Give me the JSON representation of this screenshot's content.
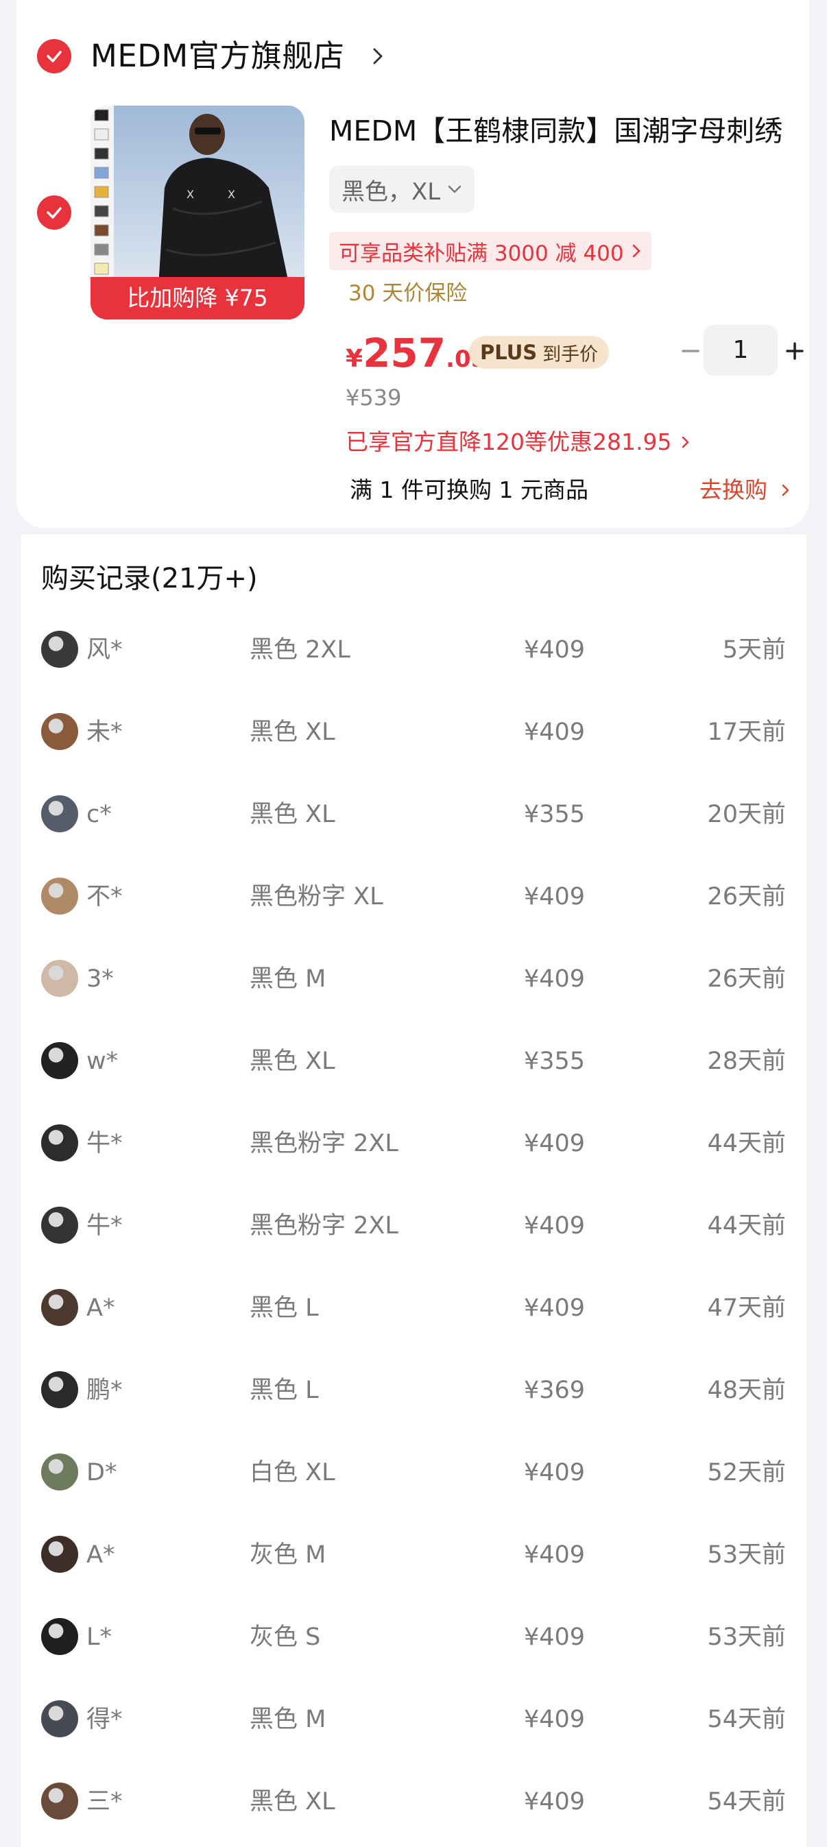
{
  "store": {
    "name": "MEDM官方旗舰店",
    "chevron_icon": "chevron-right-icon"
  },
  "product": {
    "title": "MEDM【王鹤棣同款】国潮字母刺绣",
    "badge": "比加购降 ¥75",
    "variant": "黑色，XL",
    "subsidy": "可享品类补贴满 3000 减 400",
    "protection": "30 天价保险",
    "price_currency": "¥",
    "price_integer": "257",
    "price_decimal": ".05",
    "plus_label": "PLUS",
    "plus_suffix": "到手价",
    "quantity": "1",
    "original_price": "¥539",
    "discount_text": "已享官方直降120等优惠281.95",
    "exchange_text": "满 1 件可换购 1 元商品",
    "exchange_link": "去换购",
    "accent_color": "#e8323c"
  },
  "records": {
    "title": "购买记录(21万+)",
    "rows": [
      {
        "user": "风*",
        "spec": "黑色 2XL",
        "price": "¥409",
        "time": "5天前"
      },
      {
        "user": "未*",
        "spec": "黑色 XL",
        "price": "¥409",
        "time": "17天前"
      },
      {
        "user": "c*",
        "spec": "黑色 XL",
        "price": "¥355",
        "time": "20天前"
      },
      {
        "user": "不*",
        "spec": "黑色粉字 XL",
        "price": "¥409",
        "time": "26天前"
      },
      {
        "user": "3*",
        "spec": "黑色 M",
        "price": "¥409",
        "time": "26天前"
      },
      {
        "user": "w*",
        "spec": "黑色 XL",
        "price": "¥355",
        "time": "28天前"
      },
      {
        "user": "牛*",
        "spec": "黑色粉字 2XL",
        "price": "¥409",
        "time": "44天前"
      },
      {
        "user": "牛*",
        "spec": "黑色粉字 2XL",
        "price": "¥409",
        "time": "44天前"
      },
      {
        "user": "A*",
        "spec": "黑色 L",
        "price": "¥409",
        "time": "47天前"
      },
      {
        "user": "鹏*",
        "spec": "黑色 L",
        "price": "¥369",
        "time": "48天前"
      },
      {
        "user": "D*",
        "spec": "白色 XL",
        "price": "¥409",
        "time": "52天前"
      },
      {
        "user": "A*",
        "spec": "灰色 M",
        "price": "¥409",
        "time": "53天前"
      },
      {
        "user": "L*",
        "spec": "灰色 S",
        "price": "¥409",
        "time": "53天前"
      },
      {
        "user": "得*",
        "spec": "黑色 M",
        "price": "¥409",
        "time": "54天前"
      },
      {
        "user": "三*",
        "spec": "黑色 XL",
        "price": "¥409",
        "time": "54天前"
      }
    ]
  }
}
